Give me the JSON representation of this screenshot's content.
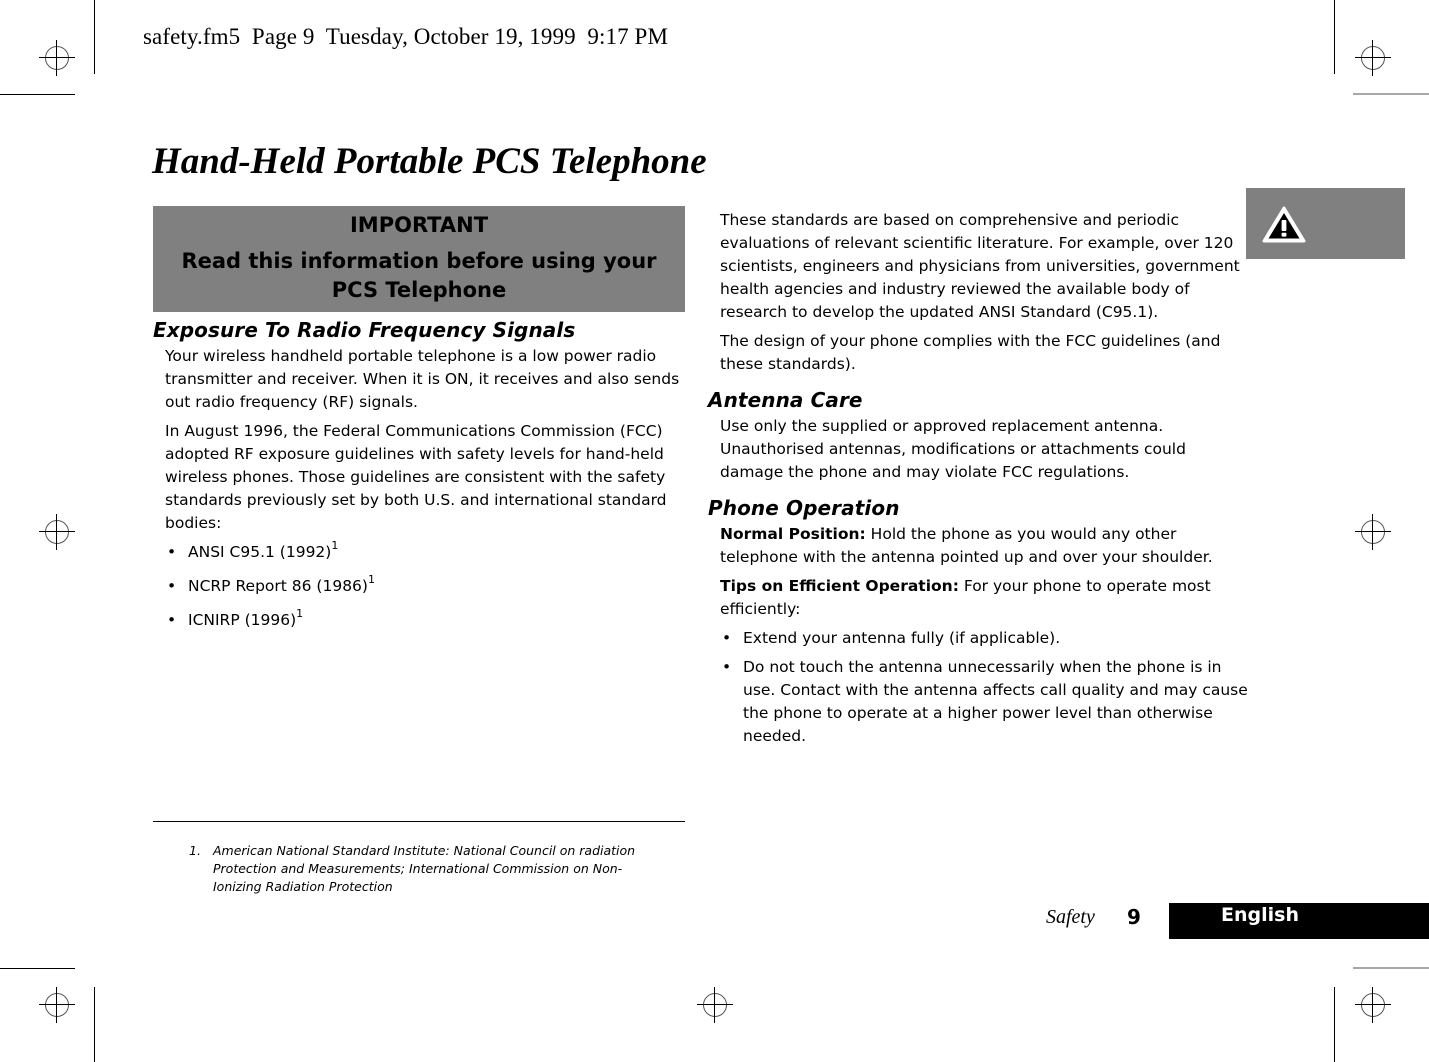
{
  "slug": {
    "text": "safety.fm5  Page 9  Tuesday, October 19, 1999  9:17 PM"
  },
  "page_title": "Hand-Held Portable PCS Telephone",
  "important_box": {
    "heading": "IMPORTANT",
    "message": "Read this information before using your PCS Telephone"
  },
  "warning_tab": {
    "icon": "warning-triangle-icon",
    "color": "#808080"
  },
  "left_column": {
    "section_title": "Exposure To Radio Frequency Signals",
    "paragraphs": [
      "Your wireless handheld portable telephone is a low power radio transmitter and receiver. When it is ON, it receives and also sends out radio frequency (RF) signals.",
      "In August 1996, the Federal Communications Commission (FCC) adopted RF exposure guidelines with safety levels for hand-held wireless phones. Those guidelines are consistent with the safety standards previously set by both U.S. and international standard bodies:"
    ],
    "standards": [
      {
        "text": "ANSI C95.1 (1992)",
        "footnote_ref": "1"
      },
      {
        "text": "NCRP Report 86 (1986)",
        "footnote_ref": "1"
      },
      {
        "text": "ICNIRP (1996)",
        "footnote_ref": "1"
      }
    ]
  },
  "right_column": {
    "intro_paragraphs": [
      "These standards are based on comprehensive and periodic evaluations of relevant scientific literature. For example, over 120 scientists, engineers and physicians from universities, government health agencies and industry reviewed the available body of research to develop the updated ANSI Standard (C95.1).",
      "The design of your phone complies with the FCC guidelines (and these standards)."
    ],
    "antenna_care": {
      "title": "Antenna Care",
      "text": "Use only the supplied or approved replacement antenna. Unauthorised antennas, modifications or attachments could damage the phone and may violate FCC regulations."
    },
    "phone_operation": {
      "title": "Phone Operation",
      "normal_position": {
        "lead": "Normal Position:",
        "text": " Hold the phone as you would any other telephone with the antenna pointed up and over your shoulder."
      },
      "tips": {
        "lead": "Tips on Efficient Operation:",
        "text": " For your phone to operate most efficiently:"
      },
      "bullets": [
        "Extend your antenna fully (if applicable).",
        "Do not touch the antenna unnecessarily when the phone is in use. Contact with the antenna affects call quality and may cause the phone to operate at a higher power level than otherwise needed."
      ]
    }
  },
  "footnote": {
    "number": "1.",
    "text": "American National Standard Institute: National Council on radiation Protection and Measurements; International Commission on Non-Ionizing Radiation Protection"
  },
  "footer": {
    "section": "Safety",
    "page_number": "9",
    "language": "English"
  }
}
